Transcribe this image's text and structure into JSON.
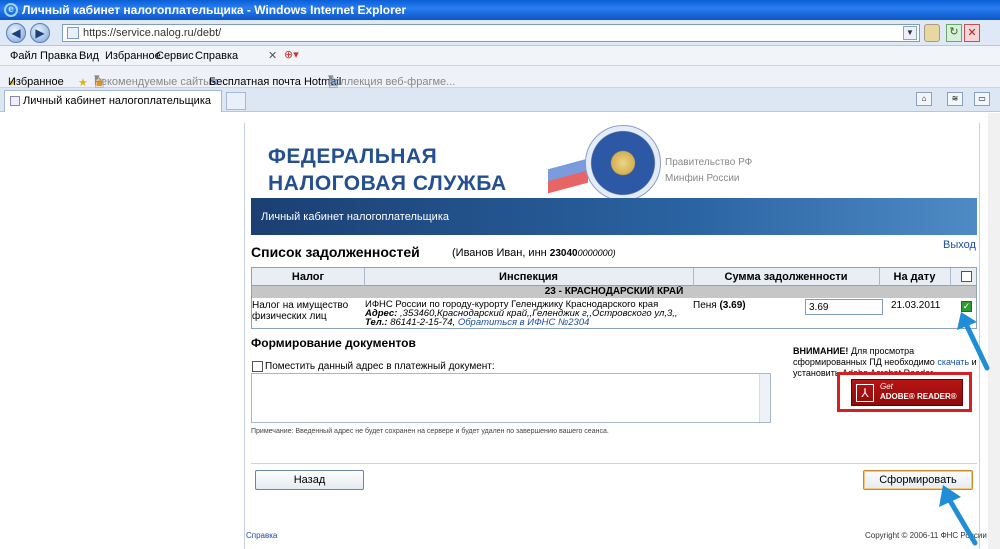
{
  "window": {
    "title": "Личный кабинет налогоплательщика - Windows Internet Explorer"
  },
  "address": {
    "url": "https://service.nalog.ru/debt/"
  },
  "menu": [
    "Файл",
    "Правка",
    "Вид",
    "Избранное",
    "Сервис",
    "Справка"
  ],
  "favorites_bar": {
    "favorites": "Избранное",
    "recommended": "Рекомендуемые сайты",
    "hotmail": "Бесплатная почта Hotmail",
    "gallery": "Коллекция веб-фрагме..."
  },
  "tab": {
    "label": "Личный кабинет налогоплательщика"
  },
  "header": {
    "title_line1": "ФЕДЕРАЛЬНАЯ",
    "title_line2": "НАЛОГОВАЯ СЛУЖБА",
    "link1": "Правительство РФ",
    "link2": "Минфин России",
    "banner": "Личный кабинет налогоплательщика"
  },
  "debts": {
    "heading": "Список задолженностей",
    "user_prefix": "(Иванов Иван, инн ",
    "inn_bold": "23040",
    "inn_rest": "0000000)",
    "exit": "Выход",
    "columns": [
      "Налог",
      "Инспекция",
      "Сумма задолженности",
      "На дату"
    ],
    "region": "23 - КРАСНОДАРСКИЙ КРАЙ",
    "row": {
      "tax": "Налог на имущество физических лиц",
      "inspection": "ИФНС России по городу-курорту Геленджику Краснодарского края",
      "address_label": "Адрес:",
      "address": ",353460,Краснодарский край,,Геленджик г,,Островского ул,3,,",
      "phone_label": "Тел.:",
      "phone": "86141-2-15-74,",
      "contact_link": "Обратиться в ИФНС №2304",
      "penalty_label": "Пеня",
      "penalty_value": "(3.69)",
      "amount": "3.69",
      "date": "21.03.2011"
    }
  },
  "forming": {
    "heading": "Формирование документов",
    "checkbox_label": "Поместить данный адрес в платежный документ:",
    "note": "Примечание: Введенный адрес не будет сохранен на сервере и будет удален по завершению вашего сеанса.",
    "warning_bold": "ВНИМАНИЕ!",
    "warning_text": " Для просмотра сформированных ПД необходимо ",
    "warning_link": "скачать",
    "warning_tail": " и установить Adobe Acrobat Reader",
    "adobe_get": "Get",
    "adobe_name": "ADOBE® READER®"
  },
  "buttons": {
    "back": "Назад",
    "submit": "Сформировать"
  },
  "footer": {
    "help": "Справка",
    "copyright": "Copyright © 2006-11 ФНС России"
  },
  "colors": {
    "brand": "#24508f",
    "arrow": "#1f8ed6",
    "highlight": "#d42020"
  }
}
